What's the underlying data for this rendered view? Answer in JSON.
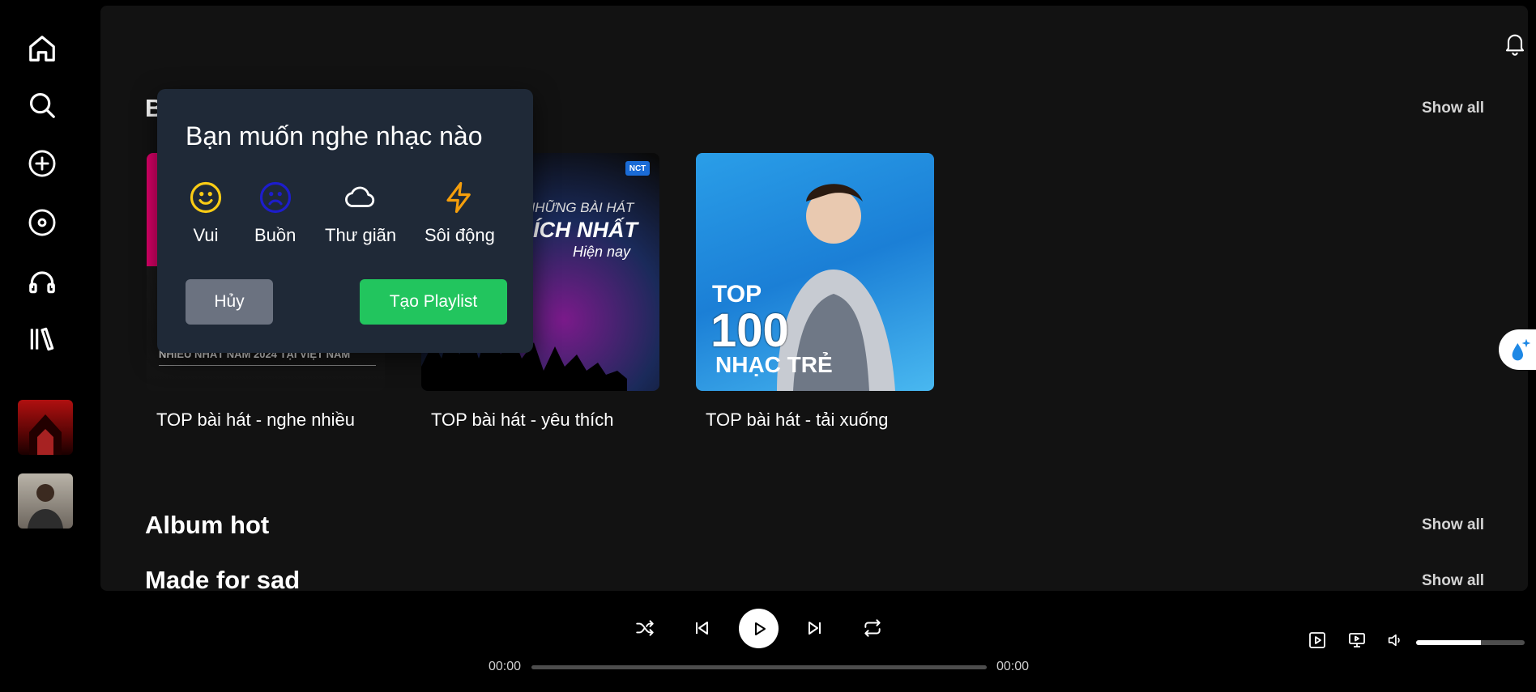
{
  "sections": {
    "first": {
      "title": "B",
      "show_all": "Show all"
    },
    "album_hot": {
      "title": "Album hot",
      "show_all": "Show all"
    },
    "made_for_sad": {
      "title": "Made for sad",
      "show_all": "Show all"
    }
  },
  "cards": [
    {
      "title": "TOP bài hát - nghe nhiều",
      "cover_text": "NHIỀU NHẤT NĂM 2024 TẠI VIỆT NAM"
    },
    {
      "title": "TOP bài hát - yêu thích",
      "cover_line1": "NHỮNG BÀI HÁT",
      "cover_line2": "ÍCH NHẤT",
      "cover_line3": "Hiện nay",
      "badge": "NCT"
    },
    {
      "title": "TOP bài hát - tải xuống",
      "cover_top": "TOP",
      "cover_num": "100",
      "cover_sub": "NHẠC TRẺ"
    }
  ],
  "modal": {
    "title": "Bạn muốn nghe nhạc nào",
    "moods": [
      {
        "label": "Vui",
        "icon": "smile-icon",
        "color": "#facc15"
      },
      {
        "label": "Buồn",
        "icon": "sad-icon",
        "color": "#1d1dcc"
      },
      {
        "label": "Thư giãn",
        "icon": "cloud-icon",
        "color": "#ffffff"
      },
      {
        "label": "Sôi động",
        "icon": "lightning-icon",
        "color": "#f59e0b"
      }
    ],
    "cancel_label": "Hủy",
    "create_label": "Tạo Playlist"
  },
  "player": {
    "current_time": "00:00",
    "total_time": "00:00",
    "progress": 0,
    "volume": 0.6
  },
  "colors": {
    "accent": "#22c55e",
    "modal_bg": "#1f2937",
    "main_bg": "#121212"
  }
}
